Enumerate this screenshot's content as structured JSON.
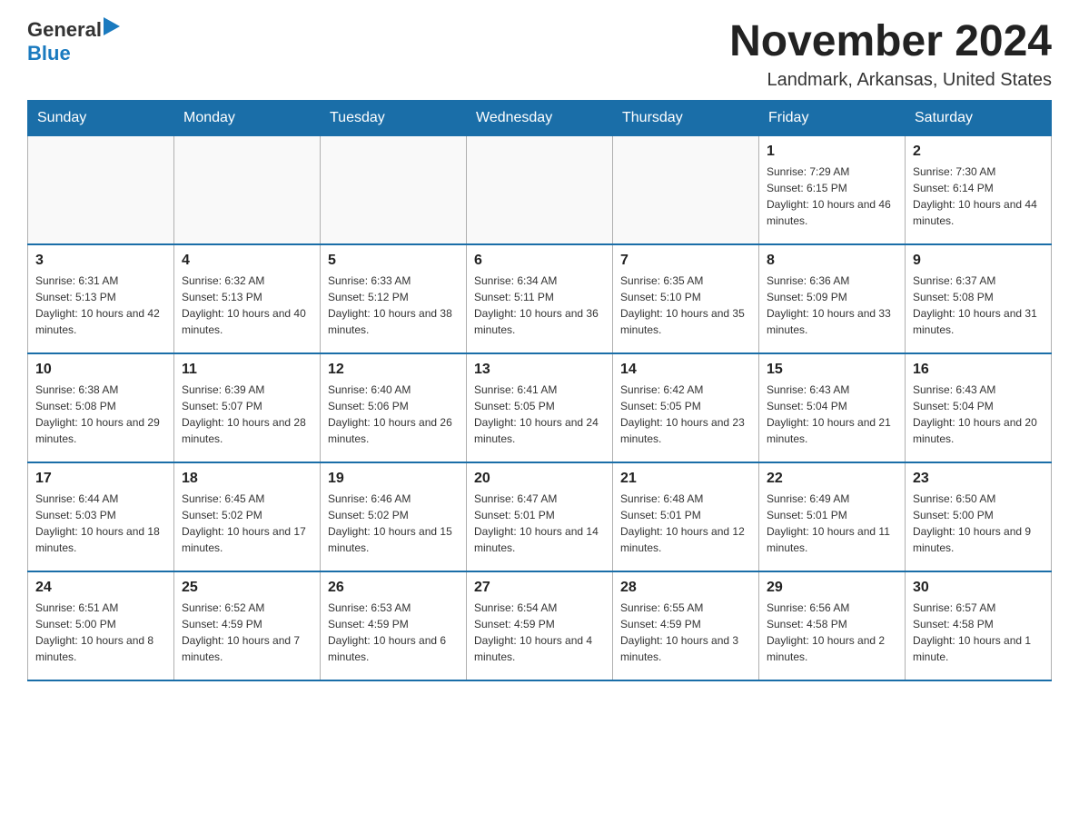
{
  "header": {
    "logo_general": "General",
    "logo_blue": "Blue",
    "main_title": "November 2024",
    "subtitle": "Landmark, Arkansas, United States"
  },
  "calendar": {
    "days_of_week": [
      "Sunday",
      "Monday",
      "Tuesday",
      "Wednesday",
      "Thursday",
      "Friday",
      "Saturday"
    ],
    "weeks": [
      [
        {
          "day": "",
          "sunrise": "",
          "sunset": "",
          "daylight": ""
        },
        {
          "day": "",
          "sunrise": "",
          "sunset": "",
          "daylight": ""
        },
        {
          "day": "",
          "sunrise": "",
          "sunset": "",
          "daylight": ""
        },
        {
          "day": "",
          "sunrise": "",
          "sunset": "",
          "daylight": ""
        },
        {
          "day": "",
          "sunrise": "",
          "sunset": "",
          "daylight": ""
        },
        {
          "day": "1",
          "sunrise": "Sunrise: 7:29 AM",
          "sunset": "Sunset: 6:15 PM",
          "daylight": "Daylight: 10 hours and 46 minutes."
        },
        {
          "day": "2",
          "sunrise": "Sunrise: 7:30 AM",
          "sunset": "Sunset: 6:14 PM",
          "daylight": "Daylight: 10 hours and 44 minutes."
        }
      ],
      [
        {
          "day": "3",
          "sunrise": "Sunrise: 6:31 AM",
          "sunset": "Sunset: 5:13 PM",
          "daylight": "Daylight: 10 hours and 42 minutes."
        },
        {
          "day": "4",
          "sunrise": "Sunrise: 6:32 AM",
          "sunset": "Sunset: 5:13 PM",
          "daylight": "Daylight: 10 hours and 40 minutes."
        },
        {
          "day": "5",
          "sunrise": "Sunrise: 6:33 AM",
          "sunset": "Sunset: 5:12 PM",
          "daylight": "Daylight: 10 hours and 38 minutes."
        },
        {
          "day": "6",
          "sunrise": "Sunrise: 6:34 AM",
          "sunset": "Sunset: 5:11 PM",
          "daylight": "Daylight: 10 hours and 36 minutes."
        },
        {
          "day": "7",
          "sunrise": "Sunrise: 6:35 AM",
          "sunset": "Sunset: 5:10 PM",
          "daylight": "Daylight: 10 hours and 35 minutes."
        },
        {
          "day": "8",
          "sunrise": "Sunrise: 6:36 AM",
          "sunset": "Sunset: 5:09 PM",
          "daylight": "Daylight: 10 hours and 33 minutes."
        },
        {
          "day": "9",
          "sunrise": "Sunrise: 6:37 AM",
          "sunset": "Sunset: 5:08 PM",
          "daylight": "Daylight: 10 hours and 31 minutes."
        }
      ],
      [
        {
          "day": "10",
          "sunrise": "Sunrise: 6:38 AM",
          "sunset": "Sunset: 5:08 PM",
          "daylight": "Daylight: 10 hours and 29 minutes."
        },
        {
          "day": "11",
          "sunrise": "Sunrise: 6:39 AM",
          "sunset": "Sunset: 5:07 PM",
          "daylight": "Daylight: 10 hours and 28 minutes."
        },
        {
          "day": "12",
          "sunrise": "Sunrise: 6:40 AM",
          "sunset": "Sunset: 5:06 PM",
          "daylight": "Daylight: 10 hours and 26 minutes."
        },
        {
          "day": "13",
          "sunrise": "Sunrise: 6:41 AM",
          "sunset": "Sunset: 5:05 PM",
          "daylight": "Daylight: 10 hours and 24 minutes."
        },
        {
          "day": "14",
          "sunrise": "Sunrise: 6:42 AM",
          "sunset": "Sunset: 5:05 PM",
          "daylight": "Daylight: 10 hours and 23 minutes."
        },
        {
          "day": "15",
          "sunrise": "Sunrise: 6:43 AM",
          "sunset": "Sunset: 5:04 PM",
          "daylight": "Daylight: 10 hours and 21 minutes."
        },
        {
          "day": "16",
          "sunrise": "Sunrise: 6:43 AM",
          "sunset": "Sunset: 5:04 PM",
          "daylight": "Daylight: 10 hours and 20 minutes."
        }
      ],
      [
        {
          "day": "17",
          "sunrise": "Sunrise: 6:44 AM",
          "sunset": "Sunset: 5:03 PM",
          "daylight": "Daylight: 10 hours and 18 minutes."
        },
        {
          "day": "18",
          "sunrise": "Sunrise: 6:45 AM",
          "sunset": "Sunset: 5:02 PM",
          "daylight": "Daylight: 10 hours and 17 minutes."
        },
        {
          "day": "19",
          "sunrise": "Sunrise: 6:46 AM",
          "sunset": "Sunset: 5:02 PM",
          "daylight": "Daylight: 10 hours and 15 minutes."
        },
        {
          "day": "20",
          "sunrise": "Sunrise: 6:47 AM",
          "sunset": "Sunset: 5:01 PM",
          "daylight": "Daylight: 10 hours and 14 minutes."
        },
        {
          "day": "21",
          "sunrise": "Sunrise: 6:48 AM",
          "sunset": "Sunset: 5:01 PM",
          "daylight": "Daylight: 10 hours and 12 minutes."
        },
        {
          "day": "22",
          "sunrise": "Sunrise: 6:49 AM",
          "sunset": "Sunset: 5:01 PM",
          "daylight": "Daylight: 10 hours and 11 minutes."
        },
        {
          "day": "23",
          "sunrise": "Sunrise: 6:50 AM",
          "sunset": "Sunset: 5:00 PM",
          "daylight": "Daylight: 10 hours and 9 minutes."
        }
      ],
      [
        {
          "day": "24",
          "sunrise": "Sunrise: 6:51 AM",
          "sunset": "Sunset: 5:00 PM",
          "daylight": "Daylight: 10 hours and 8 minutes."
        },
        {
          "day": "25",
          "sunrise": "Sunrise: 6:52 AM",
          "sunset": "Sunset: 4:59 PM",
          "daylight": "Daylight: 10 hours and 7 minutes."
        },
        {
          "day": "26",
          "sunrise": "Sunrise: 6:53 AM",
          "sunset": "Sunset: 4:59 PM",
          "daylight": "Daylight: 10 hours and 6 minutes."
        },
        {
          "day": "27",
          "sunrise": "Sunrise: 6:54 AM",
          "sunset": "Sunset: 4:59 PM",
          "daylight": "Daylight: 10 hours and 4 minutes."
        },
        {
          "day": "28",
          "sunrise": "Sunrise: 6:55 AM",
          "sunset": "Sunset: 4:59 PM",
          "daylight": "Daylight: 10 hours and 3 minutes."
        },
        {
          "day": "29",
          "sunrise": "Sunrise: 6:56 AM",
          "sunset": "Sunset: 4:58 PM",
          "daylight": "Daylight: 10 hours and 2 minutes."
        },
        {
          "day": "30",
          "sunrise": "Sunrise: 6:57 AM",
          "sunset": "Sunset: 4:58 PM",
          "daylight": "Daylight: 10 hours and 1 minute."
        }
      ]
    ]
  }
}
